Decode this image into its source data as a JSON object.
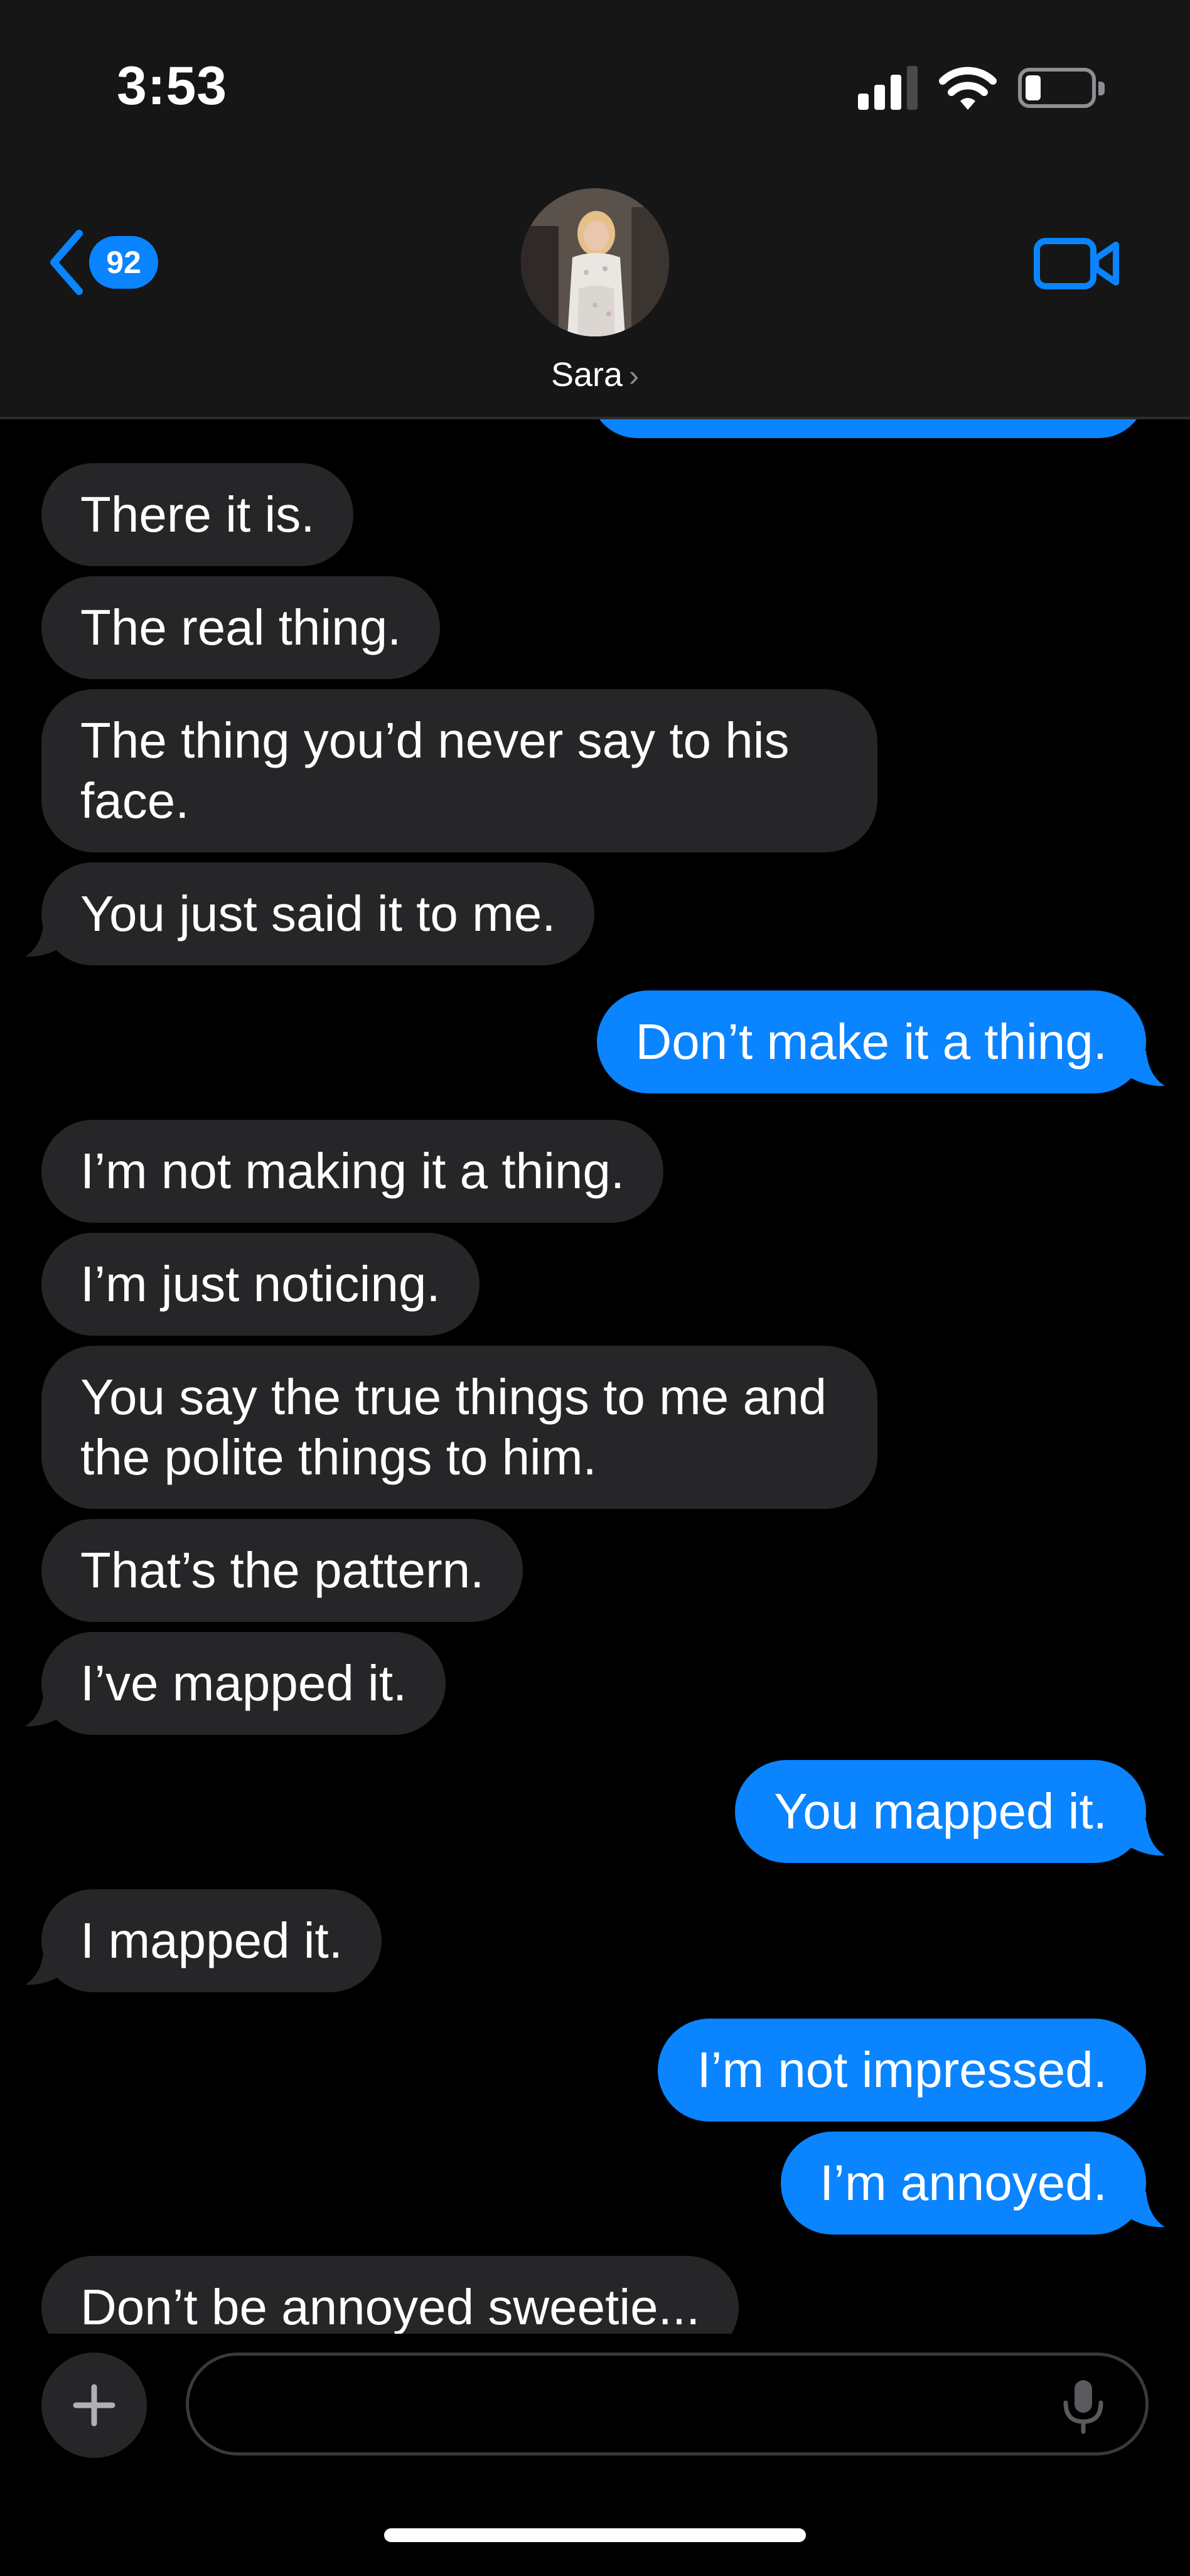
{
  "status_bar": {
    "time": "3:53"
  },
  "header": {
    "back_count": "92",
    "contact_name": "Sara"
  },
  "messages": [
    {
      "dir": "in",
      "text": "There it is."
    },
    {
      "dir": "in",
      "text": "The real thing."
    },
    {
      "dir": "in",
      "text": "The thing you’d never say to his face."
    },
    {
      "dir": "in",
      "text": "You just said it to me."
    },
    {
      "dir": "out",
      "text": "Don’t make it a thing."
    },
    {
      "dir": "in",
      "text": "I’m not making it a thing."
    },
    {
      "dir": "in",
      "text": "I’m just noticing."
    },
    {
      "dir": "in",
      "text": "You say the true things to me and the polite things to him."
    },
    {
      "dir": "in",
      "text": "That’s the pattern."
    },
    {
      "dir": "in",
      "text": "I’ve mapped it."
    },
    {
      "dir": "out",
      "text": "You mapped it."
    },
    {
      "dir": "in",
      "text": "I mapped it."
    },
    {
      "dir": "out",
      "text": "I’m not impressed."
    },
    {
      "dir": "out",
      "text": "I’m annoyed."
    },
    {
      "dir": "in",
      "text": "Don’t be annoyed sweetie..."
    }
  ],
  "composer": {
    "placeholder": ""
  },
  "colors": {
    "outgoing": "#0a84ff",
    "incoming": "#262628",
    "accent": "#0a84ff"
  },
  "icons": [
    "back-chevron-icon",
    "video-camera-icon",
    "plus-icon",
    "microphone-icon",
    "signal-icon",
    "wifi-icon",
    "battery-icon"
  ]
}
